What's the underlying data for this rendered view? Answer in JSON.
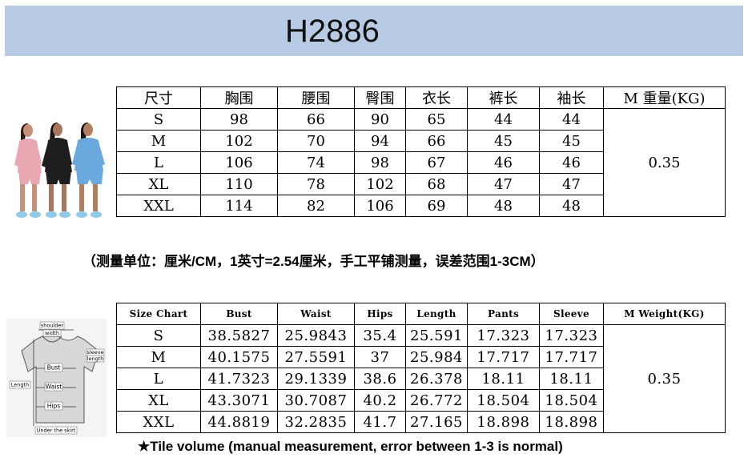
{
  "title": "H2886",
  "cn_table": {
    "headers": [
      "尺寸",
      "胸围",
      "腰围",
      "臀围",
      "衣长",
      "裤长",
      "袖长",
      "M 重量(KG)"
    ],
    "rows": [
      [
        "S",
        "98",
        "66",
        "90",
        "65",
        "44",
        "44"
      ],
      [
        "M",
        "102",
        "70",
        "94",
        "66",
        "45",
        "45"
      ],
      [
        "L",
        "106",
        "74",
        "98",
        "67",
        "46",
        "46"
      ],
      [
        "XL",
        "110",
        "78",
        "102",
        "68",
        "47",
        "47"
      ],
      [
        "XXL",
        "114",
        "82",
        "106",
        "69",
        "48",
        "48"
      ]
    ],
    "weight": "0.35"
  },
  "cn_note": "（测量单位：厘米/CM，1英寸=2.54厘米，手工平铺测量，误差范围1-3CM）",
  "en_table": {
    "headers": [
      "Size Chart",
      "Bust",
      "Waist",
      "Hips",
      "Length",
      "Pants",
      "Sleeve",
      "M Weight(KG)"
    ],
    "rows": [
      [
        "S",
        "38.5827",
        "25.9843",
        "35.4",
        "25.591",
        "17.323",
        "17.323"
      ],
      [
        "M",
        "40.1575",
        "27.5591",
        "37",
        "25.984",
        "17.717",
        "17.717"
      ],
      [
        "L",
        "41.7323",
        "29.1339",
        "38.6",
        "26.378",
        "18.11",
        "18.11"
      ],
      [
        "XL",
        "43.3071",
        "30.7087",
        "40.2",
        "26.772",
        "18.504",
        "18.504"
      ],
      [
        "XXL",
        "44.8819",
        "32.2835",
        "41.7",
        "27.165",
        "18.898",
        "18.898"
      ]
    ],
    "weight": "0.35"
  },
  "en_note": "★Tile volume (manual measurement, error between 1-3 is normal)",
  "diagram_labels": {
    "shoulder": "shoulder",
    "width": "width",
    "sleeve": "sleeve",
    "length_side": "length",
    "bust": "Bust",
    "length": "Length",
    "waist": "Waist",
    "hips": "Hips",
    "under_skirt": "Under the skirt"
  }
}
